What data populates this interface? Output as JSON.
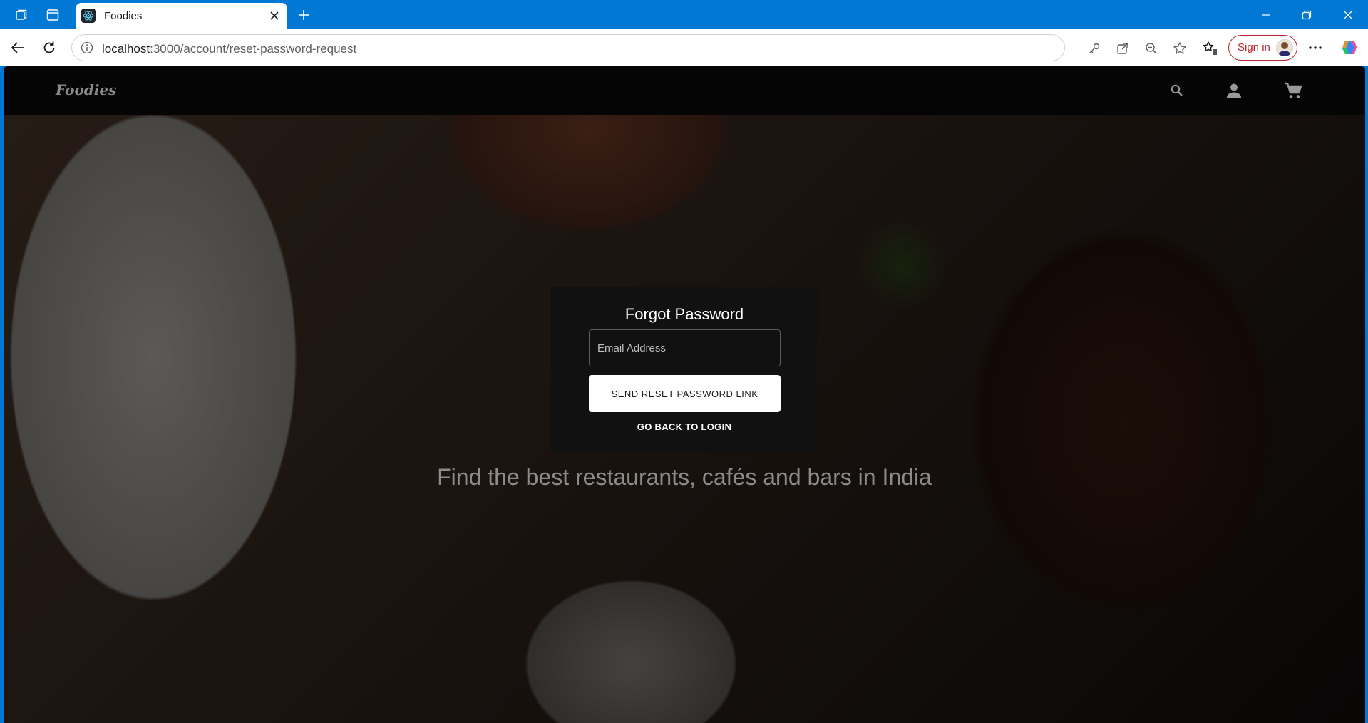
{
  "browser": {
    "tab_title": "Foodies",
    "url_host": "localhost",
    "url_path": ":3000/account/reset-password-request",
    "signin_label": "Sign in"
  },
  "app": {
    "logo": "Foodies",
    "tagline": "Find the best restaurants, cafés and bars in India"
  },
  "form": {
    "title": "Forgot Password",
    "email_placeholder": "Email Address",
    "email_value": "",
    "submit_label": "SEND RESET PASSWORD LINK",
    "back_label": "GO BACK TO LOGIN"
  }
}
